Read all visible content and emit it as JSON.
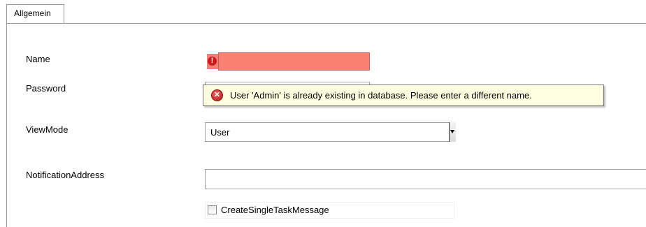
{
  "tabs": [
    {
      "label": "Allgemein"
    }
  ],
  "form": {
    "name": {
      "label": "Name",
      "value": ""
    },
    "password": {
      "label": "Password",
      "value": ""
    },
    "view_mode": {
      "label": "ViewMode",
      "selected": "User"
    },
    "notification_address": {
      "label": "NotificationAddress",
      "value": ""
    },
    "create_single_task_message": {
      "label": "CreateSingleTaskMessage",
      "checked": false
    }
  },
  "error": {
    "marker_glyph": "!",
    "tooltip_icon": "error-x-icon",
    "tooltip_glyph": "✕",
    "message": "User 'Admin' is already existing in database. Please enter a different name."
  },
  "colors": {
    "error_field": "#fa8072",
    "tooltip_bg": "#ffffe1",
    "error_icon": "#d21919"
  }
}
